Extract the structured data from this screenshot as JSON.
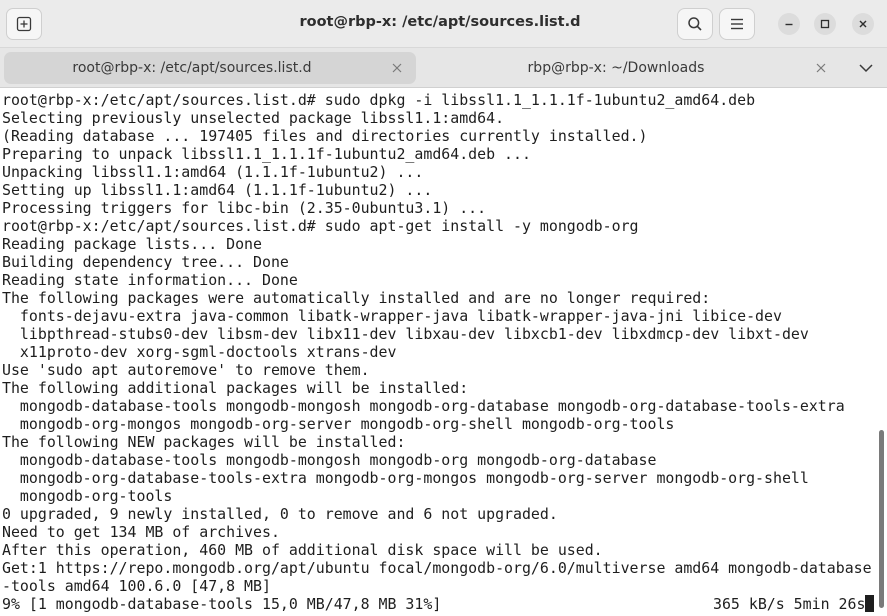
{
  "window": {
    "title": "root@rbp-x: /etc/apt/sources.list.d"
  },
  "icons": {
    "new_tab": "new-tab-icon",
    "search": "search-icon",
    "menu": "hamburger-menu-icon",
    "minimize": "minimize-icon",
    "maximize": "maximize-icon",
    "close": "close-icon",
    "tabs_dropdown": "chevron-down-icon"
  },
  "tabs": [
    {
      "label": "root@rbp-x: /etc/apt/sources.list.d",
      "active": true
    },
    {
      "label": "rbp@rbp-x: ~/Downloads",
      "active": false
    }
  ],
  "terminal": {
    "lines": [
      "root@rbp-x:/etc/apt/sources.list.d# sudo dpkg -i libssl1.1_1.1.1f-1ubuntu2_amd64.deb",
      "Selecting previously unselected package libssl1.1:amd64.",
      "(Reading database ... 197405 files and directories currently installed.)",
      "Preparing to unpack libssl1.1_1.1.1f-1ubuntu2_amd64.deb ...",
      "Unpacking libssl1.1:amd64 (1.1.1f-1ubuntu2) ...",
      "Setting up libssl1.1:amd64 (1.1.1f-1ubuntu2) ...",
      "Processing triggers for libc-bin (2.35-0ubuntu3.1) ...",
      "root@rbp-x:/etc/apt/sources.list.d# sudo apt-get install -y mongodb-org",
      "Reading package lists... Done",
      "Building dependency tree... Done",
      "Reading state information... Done",
      "The following packages were automatically installed and are no longer required:",
      "  fonts-dejavu-extra java-common libatk-wrapper-java libatk-wrapper-java-jni libice-dev",
      "  libpthread-stubs0-dev libsm-dev libx11-dev libxau-dev libxcb1-dev libxdmcp-dev libxt-dev",
      "  x11proto-dev xorg-sgml-doctools xtrans-dev",
      "Use 'sudo apt autoremove' to remove them.",
      "The following additional packages will be installed:",
      "  mongodb-database-tools mongodb-mongosh mongodb-org-database mongodb-org-database-tools-extra",
      "  mongodb-org-mongos mongodb-org-server mongodb-org-shell mongodb-org-tools",
      "The following NEW packages will be installed:",
      "  mongodb-database-tools mongodb-mongosh mongodb-org mongodb-org-database",
      "  mongodb-org-database-tools-extra mongodb-org-mongos mongodb-org-server mongodb-org-shell",
      "  mongodb-org-tools",
      "0 upgraded, 9 newly installed, 0 to remove and 6 not upgraded.",
      "Need to get 134 MB of archives.",
      "After this operation, 460 MB of additional disk space will be used.",
      "Get:1 https://repo.mongodb.org/apt/ubuntu focal/mongodb-org/6.0/multiverse amd64 mongodb-database",
      "-tools amd64 100.6.0 [47,8 MB]"
    ],
    "status_left": "9% [1 mongodb-database-tools 15,0 MB/47,8 MB 31%]",
    "status_right": "365 kB/s 5min 26s"
  }
}
